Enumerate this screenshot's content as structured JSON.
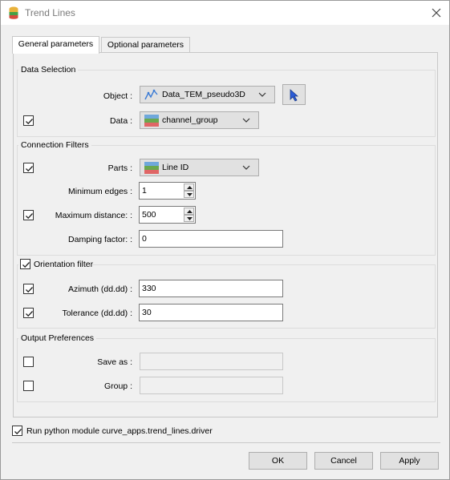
{
  "window": {
    "title": "Trend Lines"
  },
  "tabs": [
    {
      "label": "General parameters"
    },
    {
      "label": "Optional parameters"
    }
  ],
  "data_selection": {
    "title": "Data Selection",
    "object_label": "Object :",
    "object_value": "Data_TEM_pseudo3D",
    "data_label": "Data :",
    "data_value": "channel_group"
  },
  "connection_filters": {
    "title": "Connection Filters",
    "parts_label": "Parts :",
    "parts_value": "Line ID",
    "min_edges_label": "Minimum edges :",
    "min_edges_value": "1",
    "max_distance_label": "Maximum distance: :",
    "max_distance_value": "500",
    "damping_label": "Damping factor: :",
    "damping_value": "0"
  },
  "orientation_filter": {
    "title": "Orientation filter",
    "azimuth_label": "Azimuth (dd.dd) :",
    "azimuth_value": "330",
    "tolerance_label": "Tolerance (dd.dd) :",
    "tolerance_value": "30"
  },
  "output_preferences": {
    "title": "Output Preferences",
    "save_as_label": "Save as :",
    "save_as_value": "",
    "group_label": "Group :",
    "group_value": ""
  },
  "footer": {
    "run_label": "Run python module curve_apps.trend_lines.driver",
    "ok_label": "OK",
    "cancel_label": "Cancel",
    "apply_label": "Apply"
  },
  "colors": {
    "accent": "#3a6fd8",
    "panel_bg": "#f0f0f0",
    "button_bg": "#e1e1e1"
  }
}
